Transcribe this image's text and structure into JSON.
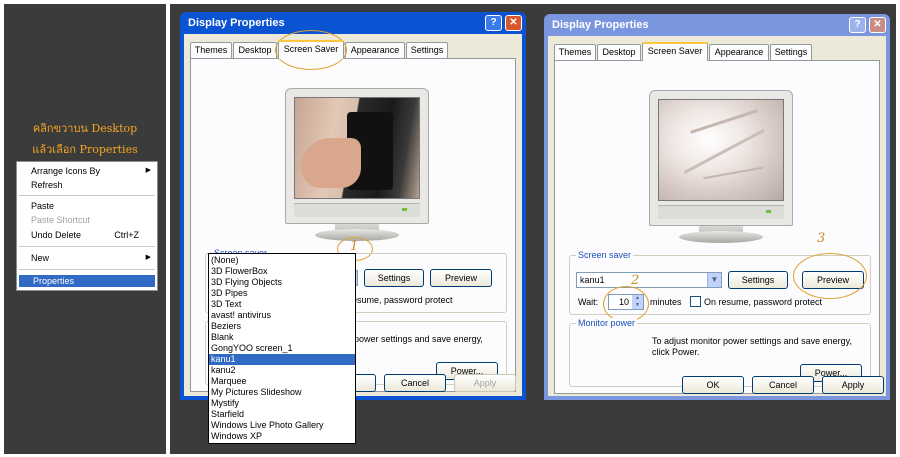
{
  "left_panel": {
    "caption_line1": "คลิกขวาบน Desktop",
    "caption_line2": "แล้วเลือก Properties",
    "context_menu": {
      "items": [
        {
          "label": "Arrange Icons By",
          "submenu": true
        },
        {
          "label": "Refresh"
        },
        {
          "label": "Paste"
        },
        {
          "label": "Paste Shortcut",
          "disabled": true
        },
        {
          "label": "Undo Delete",
          "shortcut": "Ctrl+Z"
        },
        {
          "label": "New",
          "submenu": true
        },
        {
          "label": "Properties",
          "selected": true
        }
      ]
    }
  },
  "dialog1": {
    "title": "Display Properties",
    "help_glyph": "?",
    "close_glyph": "✕",
    "tabs": [
      "Themes",
      "Desktop",
      "Screen Saver",
      "Appearance",
      "Settings"
    ],
    "active_tab": "Screen Saver",
    "screen_saver_group": "Screen saver",
    "selected_saver": "kanu1",
    "settings_label": "Settings",
    "preview_label": "Preview",
    "resume_text_partial": "esume, password protect",
    "power_text_partial_1": "power settings and save energy,",
    "power_label": "Power...",
    "ok_label": "",
    "cancel_label": "Cancel",
    "apply_label": "Apply",
    "dropdown_options": [
      "(None)",
      "3D FlowerBox",
      "3D Flying Objects",
      "3D Pipes",
      "3D Text",
      "avast! antivirus",
      "Beziers",
      "Blank",
      "GongYOO screen_1",
      "kanu1",
      "kanu2",
      "Marquee",
      "My Pictures Slideshow",
      "Mystify",
      "Starfield",
      "Windows Live Photo Gallery",
      "Windows XP"
    ],
    "dropdown_selected": "kanu1",
    "annotation_number": "1"
  },
  "dialog2": {
    "title": "Display Properties",
    "help_glyph": "?",
    "close_glyph": "✕",
    "tabs": [
      "Themes",
      "Desktop",
      "Screen Saver",
      "Appearance",
      "Settings"
    ],
    "active_tab": "Screen Saver",
    "screen_saver_group": "Screen saver",
    "selected_saver": "kanu1",
    "settings_label": "Settings",
    "preview_label": "Preview",
    "wait_label": "Wait:",
    "wait_value": "10",
    "minutes_label": "minutes",
    "resume_label": "On resume, password protect",
    "monitor_power_group": "Monitor power",
    "power_text_line1": "To adjust monitor power settings and save energy,",
    "power_text_line2": "click Power.",
    "power_label": "Power...",
    "ok_label": "OK",
    "cancel_label": "Cancel",
    "apply_label": "Apply",
    "annotation_2": "2",
    "annotation_3": "3"
  },
  "colors": {
    "dark_panel": "#3b3b3b",
    "caption": "#f5a623",
    "title_active": "#0a53d2",
    "title_inactive": "#7a96df",
    "selection": "#316ac5",
    "annotation": "#e0a030"
  }
}
